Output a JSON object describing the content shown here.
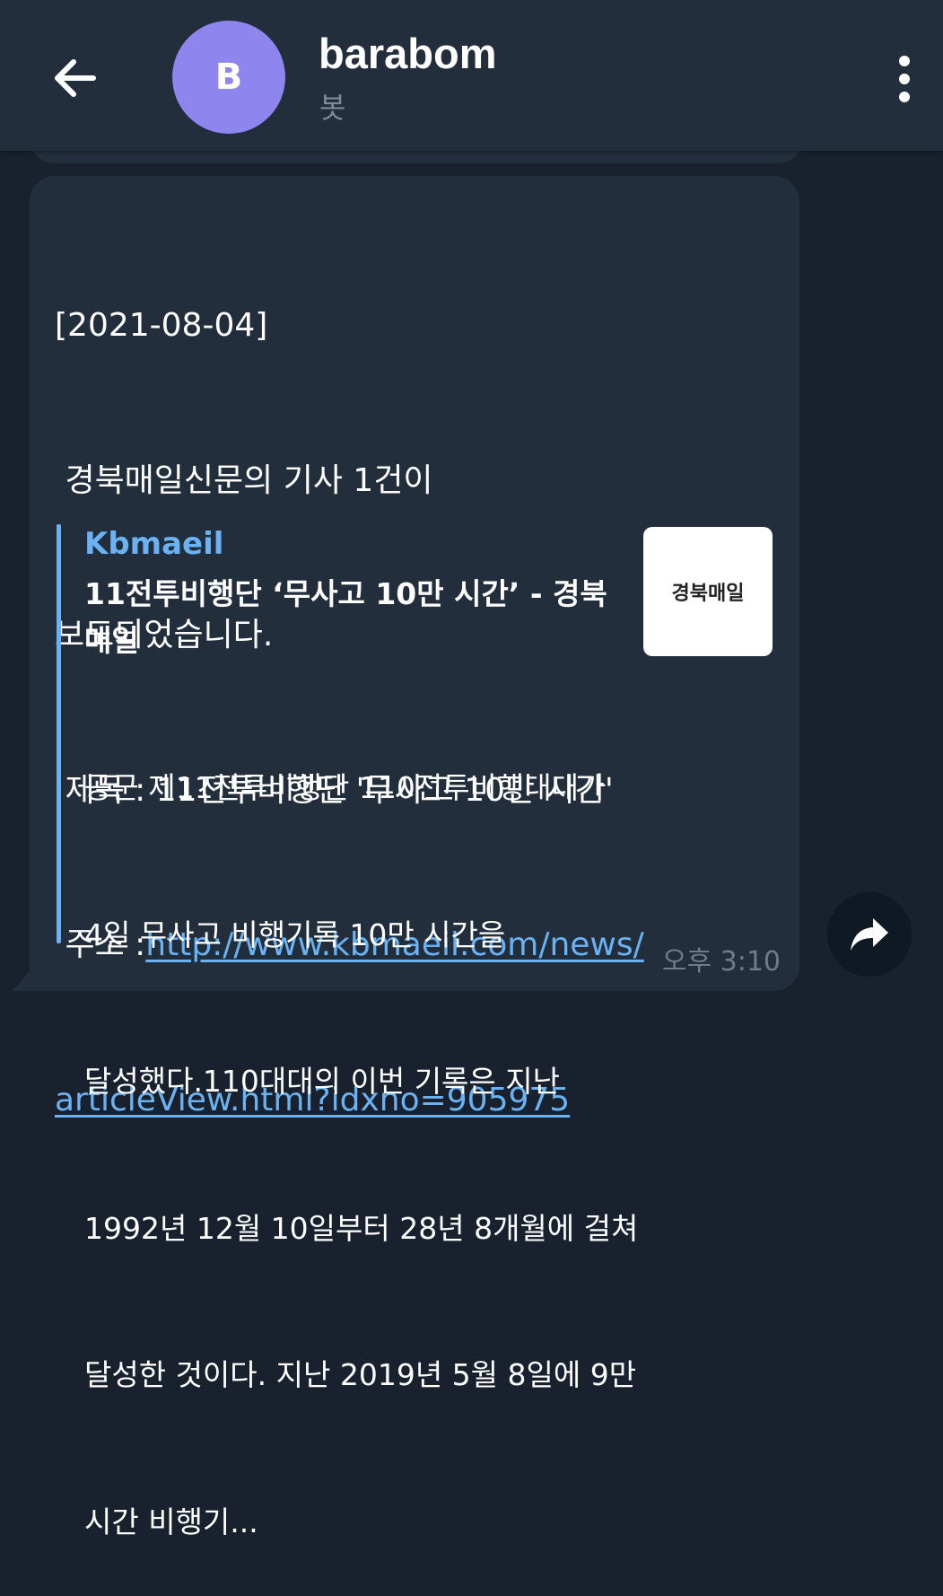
{
  "header": {
    "avatar_letter": "B",
    "avatar_color": "#8e85ee",
    "title": "barabom",
    "subtitle": "봇",
    "back_icon": "arrow-left-icon",
    "menu_icon": "more-vertical-icon"
  },
  "message": {
    "lines": [
      "[2021-08-04]",
      " 경북매일신문의 기사 1건이",
      "보도되었습니다.",
      " 제목 : 11전투비행단 '무사고 10만 시간'"
    ],
    "address_label": " 주소 :",
    "link_line1": "http://www.kbmaeil.com/news/",
    "link_line2": "articleView.html?idxno=905975",
    "link_color": "#6ab2f2",
    "time": "오후 3:10"
  },
  "preview": {
    "site": "Kbmaeil",
    "title": "11전투비행단 ‘무사고 10만 시간’ - 경북매일",
    "desc_lines": [
      "공군 제11전투비행단 110전투비행대대가",
      "4일 무사고 비행기록 10만 시간을",
      "달성했다.110대대의 이번 기록은 지난",
      "1992년 12월 10일부터 28년 8개월에 걸쳐",
      "달성한 것이다. 지난 2019년 5월 8일에 9만",
      "시간 비행기..."
    ],
    "thumb_text": "경북매일"
  },
  "share_icon": "share-forward-icon"
}
